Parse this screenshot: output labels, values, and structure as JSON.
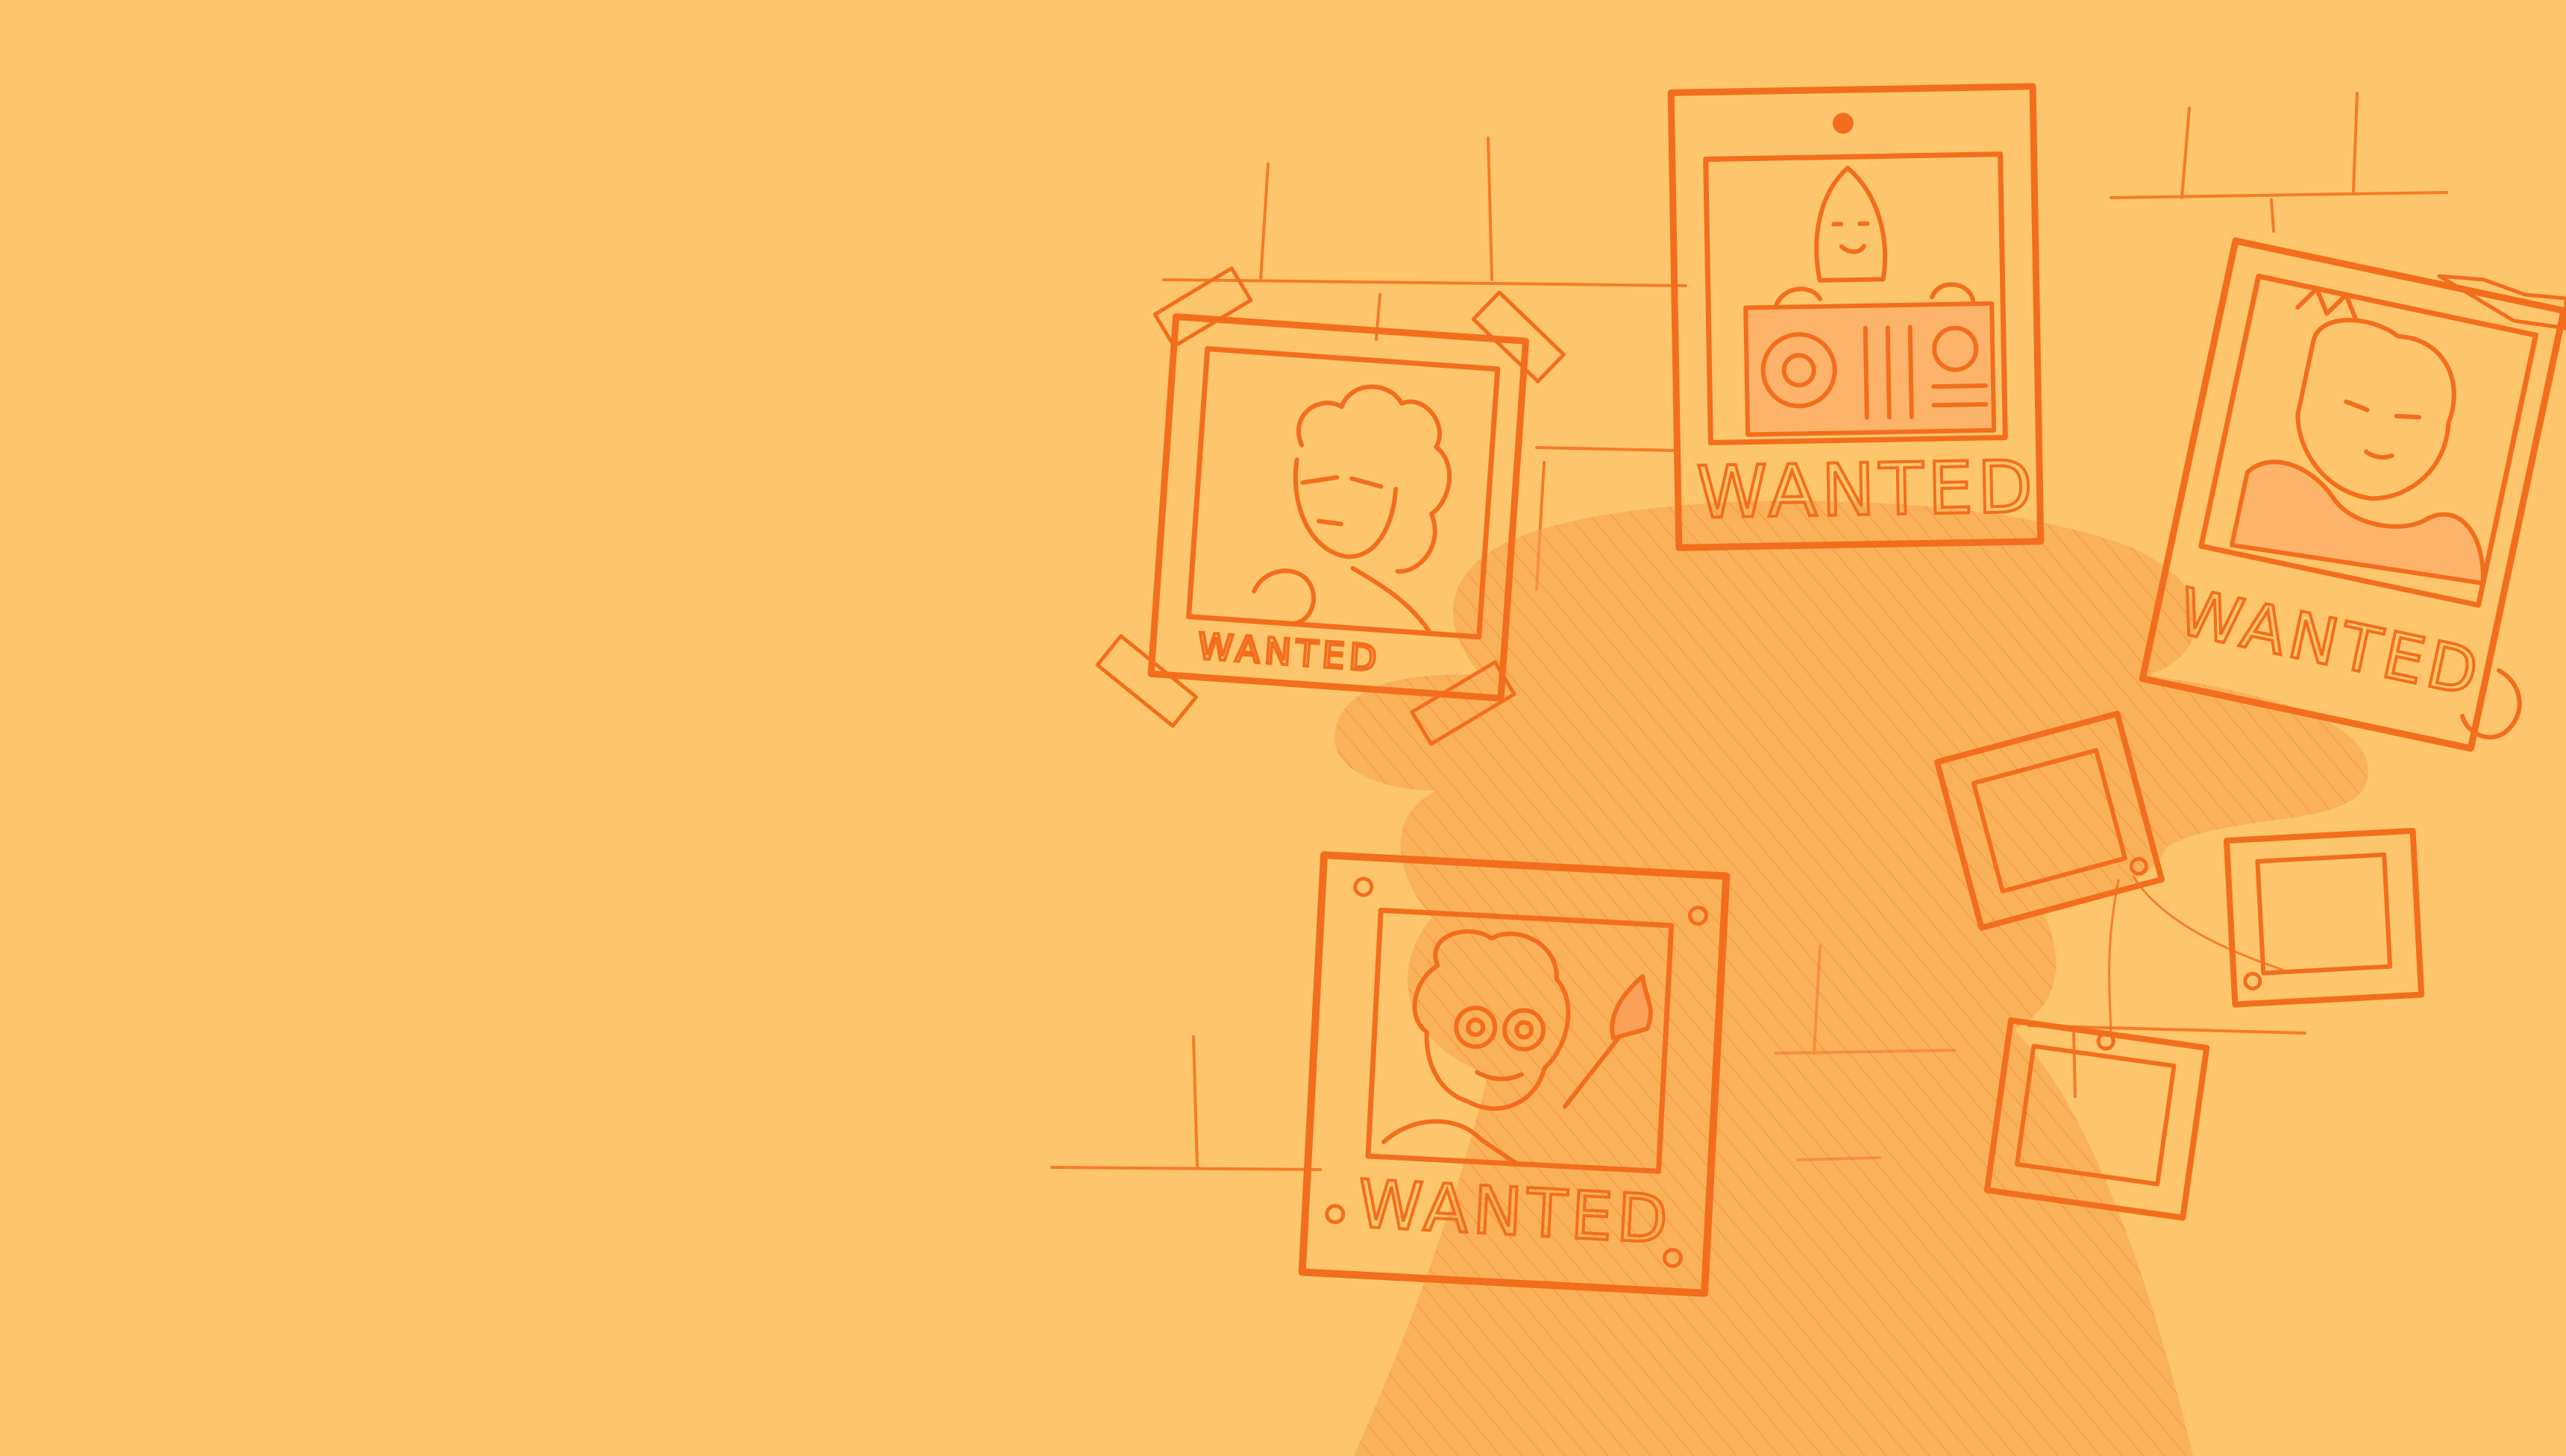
{
  "scene": {
    "background_color": "#FEC66C",
    "ink_color": "#F36E1C",
    "shade_color": "#F59A4A"
  },
  "posters": [
    {
      "name": "poster-curly-hair",
      "caption": "WANTED"
    },
    {
      "name": "poster-boombox-robot",
      "caption": "WANTED"
    },
    {
      "name": "poster-scarf-character",
      "caption": "WANTED"
    },
    {
      "name": "poster-goggles-torch",
      "caption": "WANTED"
    }
  ],
  "blank_frames": 3
}
